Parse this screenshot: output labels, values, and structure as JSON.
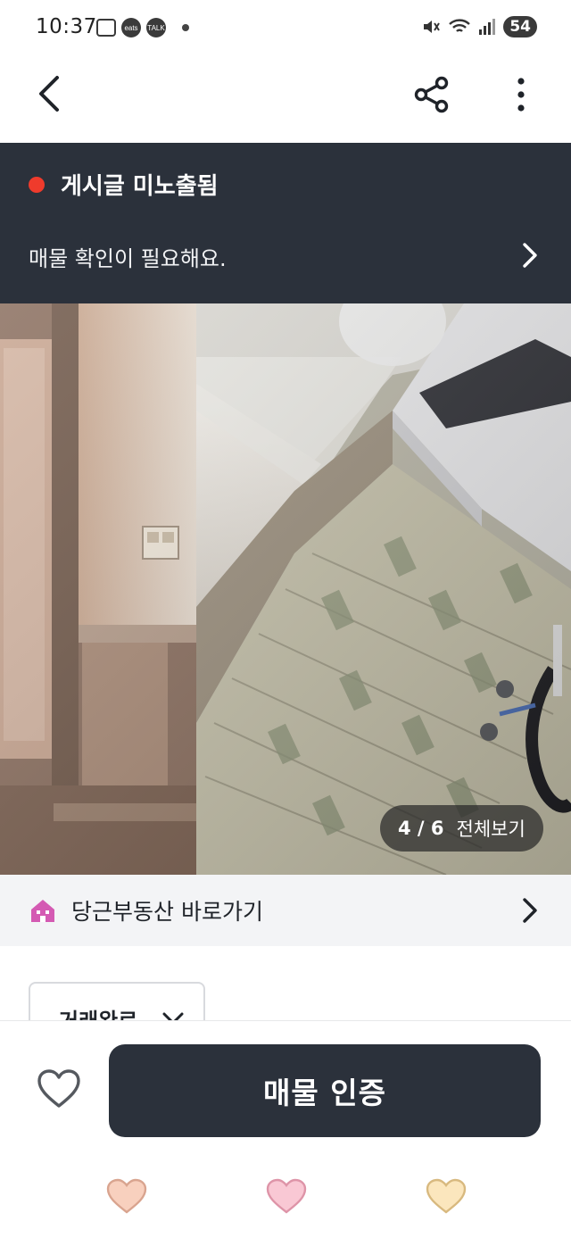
{
  "status_bar": {
    "time": "10:37",
    "app_icons": [
      "eats",
      "TALK"
    ],
    "battery_level": "54"
  },
  "app_bar": {
    "back_icon": "chevron-left-icon",
    "share_icon": "share-icon",
    "more_icon": "more-vertical-icon"
  },
  "notice": {
    "title": "게시글 미노출됨",
    "message": "매물 확인이 필요해요.",
    "accent_color": "#ef3b2c",
    "background": "#2b313b"
  },
  "gallery": {
    "counter_current": "4 / 6",
    "view_all_label": "전체보기",
    "current_index": 4,
    "total": 6
  },
  "estate_link": {
    "label": "당근부동산 바로가기",
    "icon": "house-icon"
  },
  "status_chip": {
    "label": "거래완료"
  },
  "bottom_bar": {
    "like_icon": "heart-outline-icon",
    "cta_label": "매물 인증"
  },
  "nav_bar": {
    "icons": [
      "heart-icon-orange",
      "heart-icon-pink",
      "heart-icon-yellow"
    ],
    "colors": [
      "#f8d0be",
      "#f9c8d4",
      "#fbe6bd"
    ]
  }
}
